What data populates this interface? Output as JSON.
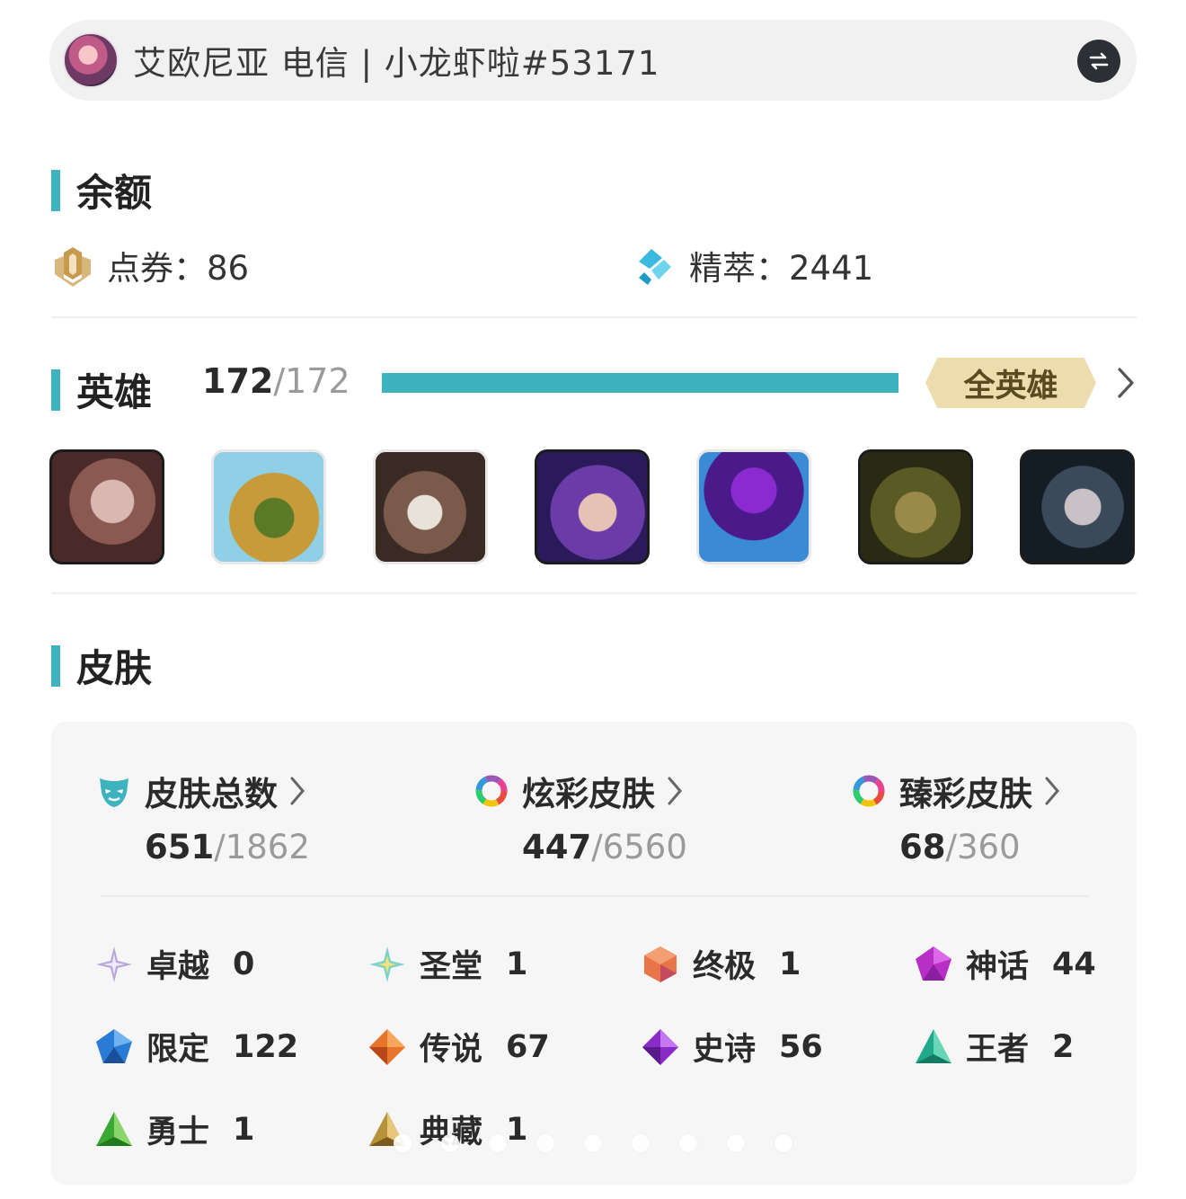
{
  "account": {
    "avatar_icon": "champion-avatar",
    "text": "艾欧尼亚  电信 | 小龙虾啦#53171",
    "switch_icon": "switch-arrows-icon"
  },
  "balance": {
    "title": "余额",
    "rp_label": "点券：86",
    "essence_label": "精萃：2441"
  },
  "heroes": {
    "title": "英雄",
    "owned": "172",
    "total": "/172",
    "progress_fraction": 1.0,
    "all_label": "全英雄",
    "portraits": [
      "champion-portrait-1",
      "champion-portrait-2",
      "champion-portrait-3",
      "champion-portrait-4",
      "champion-portrait-5",
      "champion-portrait-6",
      "champion-portrait-7"
    ]
  },
  "skins": {
    "title": "皮肤",
    "total": {
      "label": "皮肤总数",
      "owned": "651",
      "total": "/1862"
    },
    "chroma": {
      "label": "炫彩皮肤",
      "owned": "447",
      "total": "/6560"
    },
    "prestige_chroma": {
      "label": "臻彩皮肤",
      "owned": "68",
      "total": "/360"
    },
    "tiers": [
      {
        "name": "卓越",
        "count": "0"
      },
      {
        "name": "圣堂",
        "count": "1"
      },
      {
        "name": "终极",
        "count": "1"
      },
      {
        "name": "神话",
        "count": "44"
      },
      {
        "name": "限定",
        "count": "122"
      },
      {
        "name": "传说",
        "count": "67"
      },
      {
        "name": "史诗",
        "count": "56"
      },
      {
        "name": "王者",
        "count": "2"
      },
      {
        "name": "勇士",
        "count": "1"
      },
      {
        "name": "典藏",
        "count": "1"
      }
    ]
  },
  "carousel": {
    "pages": 9,
    "active": 9
  },
  "colors": {
    "accent": "#3eb3bf",
    "badge": "#ecdcae",
    "panel": "#f6f6f7"
  }
}
